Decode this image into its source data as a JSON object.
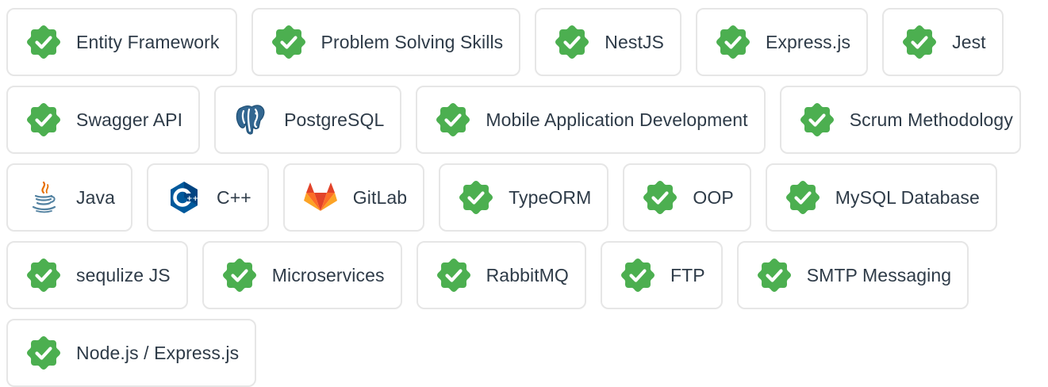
{
  "colors": {
    "check_badge": "#4caf50",
    "border": "#e6e6e6",
    "text": "#2e3b48"
  },
  "skills": [
    {
      "label": "Entity Framework",
      "icon": "check-badge-icon"
    },
    {
      "label": "Problem Solving Skills",
      "icon": "check-badge-icon"
    },
    {
      "label": "NestJS",
      "icon": "check-badge-icon"
    },
    {
      "label": "Express.js",
      "icon": "check-badge-icon"
    },
    {
      "label": "Jest",
      "icon": "check-badge-icon"
    },
    {
      "label": "Swagger API",
      "icon": "check-badge-icon"
    },
    {
      "label": "PostgreSQL",
      "icon": "postgresql-elephant-icon"
    },
    {
      "label": "Mobile Application Development",
      "icon": "check-badge-icon"
    },
    {
      "label": "Scrum Methodology",
      "icon": "check-badge-icon"
    },
    {
      "label": "Java",
      "icon": "java-coffee-cup-icon"
    },
    {
      "label": "C++",
      "icon": "cpp-hexagon-icon"
    },
    {
      "label": "GitLab",
      "icon": "gitlab-tanuki-icon"
    },
    {
      "label": "TypeORM",
      "icon": "check-badge-icon"
    },
    {
      "label": "OOP",
      "icon": "check-badge-icon"
    },
    {
      "label": "MySQL Database",
      "icon": "check-badge-icon"
    },
    {
      "label": "sequlize JS",
      "icon": "check-badge-icon"
    },
    {
      "label": "Microservices",
      "icon": "check-badge-icon"
    },
    {
      "label": "RabbitMQ",
      "icon": "check-badge-icon"
    },
    {
      "label": "FTP",
      "icon": "check-badge-icon"
    },
    {
      "label": "SMTP Messaging",
      "icon": "check-badge-icon"
    },
    {
      "label": "Node.js / Express.js",
      "icon": "check-badge-icon"
    }
  ]
}
